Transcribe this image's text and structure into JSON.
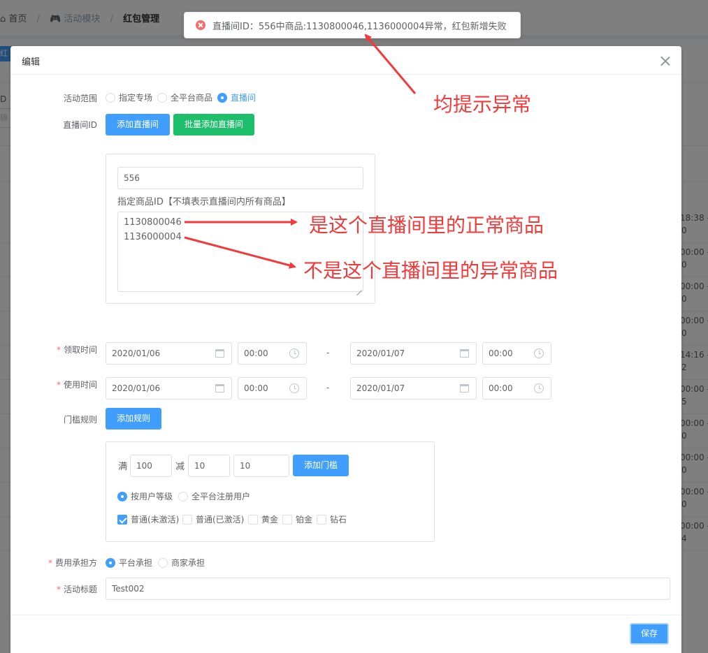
{
  "breadcrumb": {
    "home": "首页",
    "module": "活动模块",
    "current": "红包管理"
  },
  "background": {
    "tag_label": "红包",
    "filter_label_fragment": "D",
    "filter_placeholder_fragment": "输入",
    "row_times": [
      "18:38 -",
      "00:00 -",
      "00:00 -",
      "00:00 -",
      "14:16 -",
      "00:00 -",
      "00:00 -",
      "00:00 -",
      "00:00 -",
      "00:00 -"
    ],
    "row_suffix": [
      "0",
      "0",
      "0",
      "0",
      "2",
      "5",
      "0",
      "0",
      "0",
      "4"
    ]
  },
  "toast": {
    "type": "error",
    "message": "直播间ID：556中商品:1130800046,1136000004异常，红包新增失败"
  },
  "dialog": {
    "title": "编辑",
    "activity_scope": {
      "label": "活动范围",
      "options": [
        "指定专场",
        "全平台商品",
        "直播间"
      ],
      "selected": "直播间"
    },
    "live_room": {
      "label": "直播间ID",
      "add_button": "添加直播间",
      "batch_add_button": "批量添加直播间",
      "room_id": "556",
      "goods_hint": "指定商品ID【不填表示直播间内所有商品】",
      "goods_ids": "1130800046\n1136000004"
    },
    "receive_time": {
      "label": "领取时间",
      "start_date": "2020/01/06",
      "start_time": "00:00",
      "separator": "-",
      "end_date": "2020/01/07",
      "end_time": "00:00"
    },
    "use_time": {
      "label": "使用时间",
      "start_date": "2020/01/06",
      "start_time": "00:00",
      "separator": "-",
      "end_date": "2020/01/07",
      "end_time": "00:00"
    },
    "threshold": {
      "label": "门槛规则",
      "add_rule_button": "添加规则",
      "full_label": "满",
      "full_value": "100",
      "minus_label": "减",
      "minus_value": "10",
      "extra_value": "10",
      "add_threshold_button": "添加门槛",
      "user_scope_options": [
        "按用户等级",
        "全平台注册用户"
      ],
      "user_scope_selected": "按用户等级",
      "levels": [
        {
          "label": "普通(未激活)",
          "checked": true
        },
        {
          "label": "普通(已激活)",
          "checked": false
        },
        {
          "label": "黄金",
          "checked": false
        },
        {
          "label": "铂金",
          "checked": false
        },
        {
          "label": "钻石",
          "checked": false
        }
      ]
    },
    "cost_bearer": {
      "label": "费用承担方",
      "options": [
        "平台承担",
        "商家承担"
      ],
      "selected": "平台承担"
    },
    "title_field": {
      "label": "活动标题",
      "value": "Test002"
    },
    "save_button": "保存"
  },
  "annotations": {
    "toast_note": "均提示异常",
    "normal_goods_note": "是这个直播间里的正常商品",
    "abnormal_goods_note": "不是这个直播间里的异常商品"
  },
  "colors": {
    "primary": "#409eff",
    "success": "#1dbf6a",
    "danger": "#f56c6c",
    "annotation_red": "#f23a3a"
  }
}
